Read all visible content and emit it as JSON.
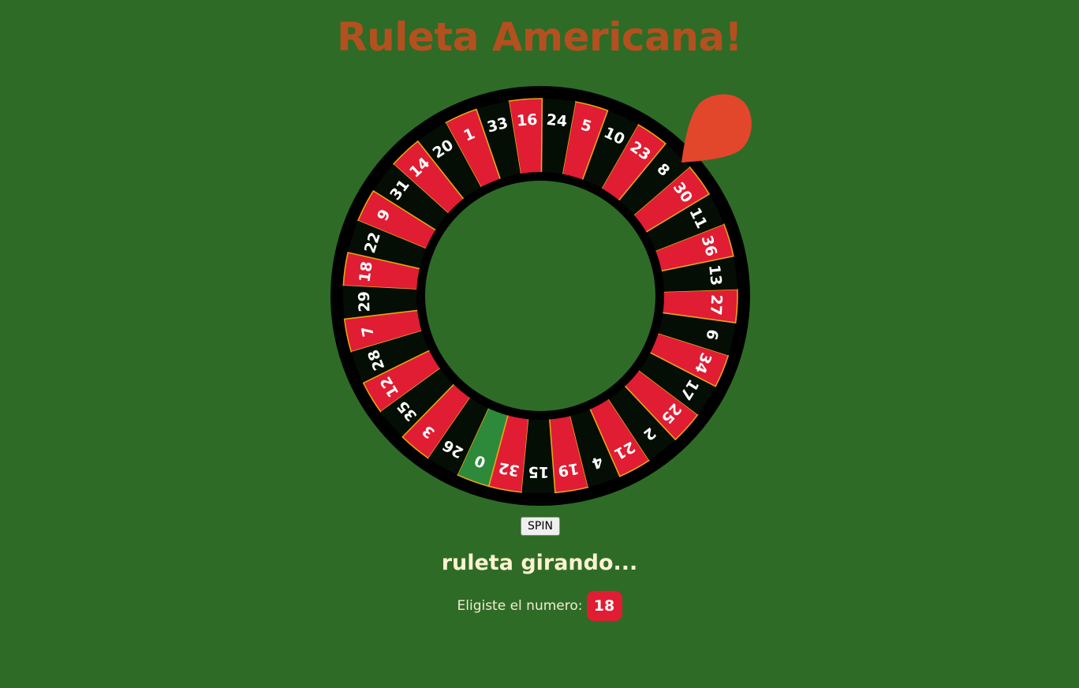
{
  "page": {
    "title": "Ruleta Americana!"
  },
  "wheel": {
    "pockets": [
      {
        "number": "0",
        "color": "green"
      },
      {
        "number": "32",
        "color": "red"
      },
      {
        "number": "15",
        "color": "black"
      },
      {
        "number": "19",
        "color": "red"
      },
      {
        "number": "4",
        "color": "black"
      },
      {
        "number": "21",
        "color": "red"
      },
      {
        "number": "2",
        "color": "black"
      },
      {
        "number": "25",
        "color": "red"
      },
      {
        "number": "17",
        "color": "black"
      },
      {
        "number": "34",
        "color": "red"
      },
      {
        "number": "6",
        "color": "black"
      },
      {
        "number": "27",
        "color": "red"
      },
      {
        "number": "13",
        "color": "black"
      },
      {
        "number": "36",
        "color": "red"
      },
      {
        "number": "11",
        "color": "black"
      },
      {
        "number": "30",
        "color": "red"
      },
      {
        "number": "8",
        "color": "black"
      },
      {
        "number": "23",
        "color": "red"
      },
      {
        "number": "10",
        "color": "black"
      },
      {
        "number": "5",
        "color": "red"
      },
      {
        "number": "24",
        "color": "black"
      },
      {
        "number": "16",
        "color": "red"
      },
      {
        "number": "33",
        "color": "black"
      },
      {
        "number": "1",
        "color": "red"
      },
      {
        "number": "20",
        "color": "black"
      },
      {
        "number": "14",
        "color": "red"
      },
      {
        "number": "31",
        "color": "black"
      },
      {
        "number": "9",
        "color": "red"
      },
      {
        "number": "22",
        "color": "black"
      },
      {
        "number": "18",
        "color": "red"
      },
      {
        "number": "29",
        "color": "black"
      },
      {
        "number": "7",
        "color": "red"
      },
      {
        "number": "28",
        "color": "black"
      },
      {
        "number": "12",
        "color": "red"
      },
      {
        "number": "35",
        "color": "black"
      },
      {
        "number": "3",
        "color": "red"
      },
      {
        "number": "26",
        "color": "black"
      }
    ],
    "colors": {
      "red": "#e01d33",
      "black": "#040e05",
      "green": "#2c8a3a",
      "separator": "#e8a515",
      "rim": "#000000",
      "label": "#ffffff",
      "pointer": "#e2472b",
      "background": "#2e6b27"
    }
  },
  "controls": {
    "spin_label": "SPIN"
  },
  "status": {
    "text": "ruleta girando..."
  },
  "selection": {
    "label": "Eligiste el numero:",
    "number": "18"
  }
}
